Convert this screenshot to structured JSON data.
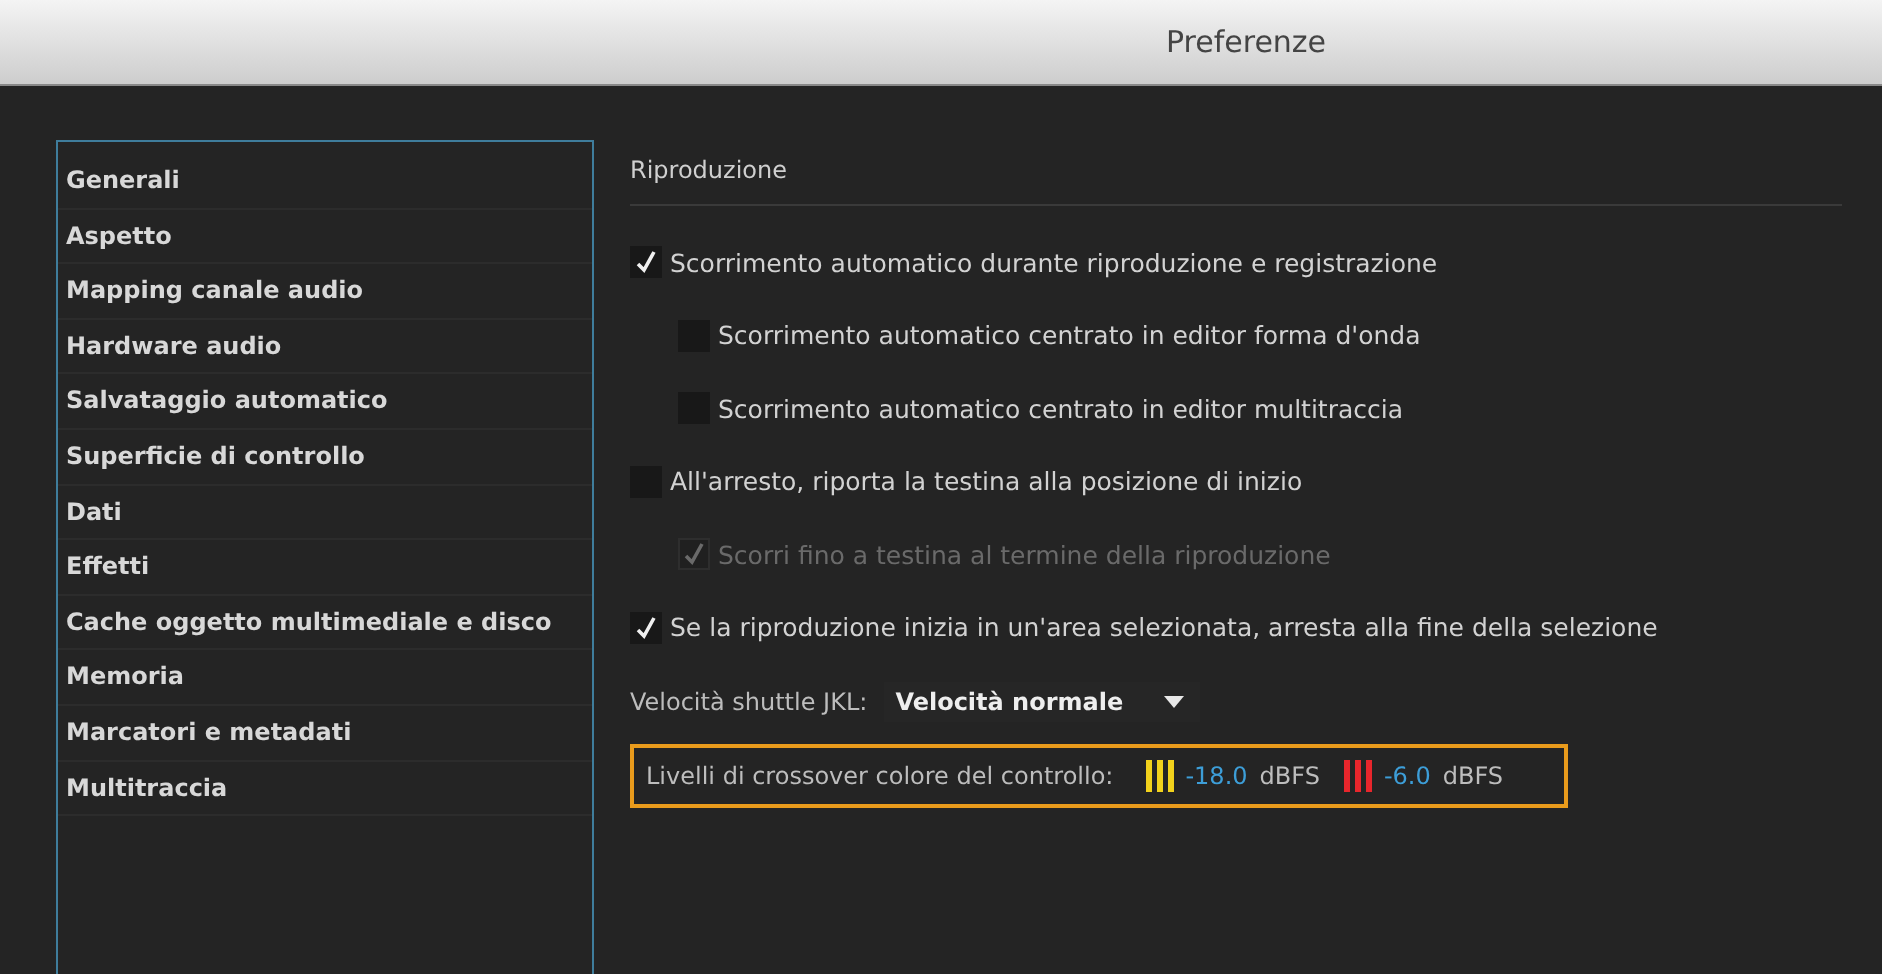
{
  "window": {
    "title": "Preferenze"
  },
  "sidebar": {
    "items": [
      {
        "label": "Generali"
      },
      {
        "label": "Aspetto"
      },
      {
        "label": "Mapping canale audio"
      },
      {
        "label": "Hardware audio"
      },
      {
        "label": "Salvataggio automatico"
      },
      {
        "label": "Superficie di controllo"
      },
      {
        "label": "Dati"
      },
      {
        "label": "Effetti"
      },
      {
        "label": "Cache oggetto multimediale e disco"
      },
      {
        "label": "Memoria"
      },
      {
        "label": "Marcatori e metadati"
      },
      {
        "label": "Multitraccia"
      }
    ]
  },
  "section": {
    "title": "Riproduzione",
    "options": [
      {
        "label": "Scorrimento automatico durante riproduzione e registrazione",
        "checked": true,
        "disabled": false,
        "children": [
          {
            "label": "Scorrimento automatico centrato in editor forma d'onda",
            "checked": false,
            "disabled": false
          },
          {
            "label": "Scorrimento automatico centrato in editor multitraccia",
            "checked": false,
            "disabled": false
          }
        ]
      },
      {
        "label": "All'arresto, riporta la testina alla posizione di inizio",
        "checked": false,
        "disabled": false,
        "children": [
          {
            "label": "Scorri fino a testina al termine della riproduzione",
            "checked": true,
            "disabled": true
          }
        ]
      },
      {
        "label": "Se la riproduzione inizia in un'area selezionata, arresta alla fine della selezione",
        "checked": true,
        "disabled": false
      }
    ],
    "shuttle": {
      "label": "Velocità shuttle JKL:",
      "value": "Velocità normale"
    },
    "crossover": {
      "label": "Livelli di crossover colore del controllo:",
      "levels": [
        {
          "color": "#f2d21c",
          "value": "-18.0",
          "unit": "dBFS"
        },
        {
          "color": "#e8262c",
          "value": "-6.0",
          "unit": "dBFS"
        }
      ]
    }
  }
}
